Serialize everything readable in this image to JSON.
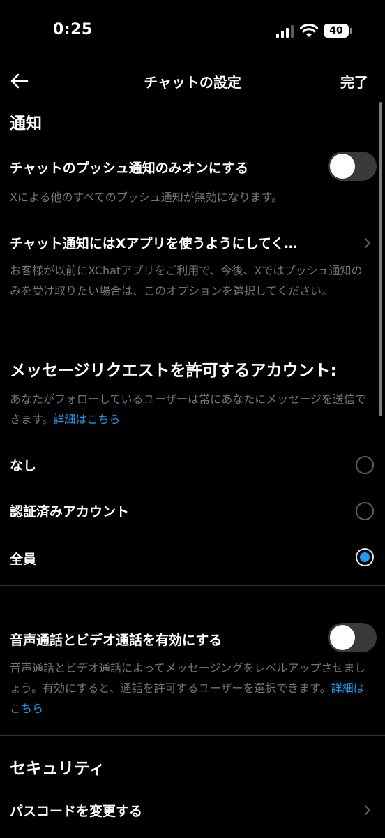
{
  "status_bar": {
    "time": "0:25",
    "battery": "40",
    "signal_icon": "cellular-signal-icon",
    "wifi_icon": "wifi-icon"
  },
  "nav": {
    "back_icon": "arrow-left-icon",
    "title": "チャットの設定",
    "done": "完了"
  },
  "notifications": {
    "heading": "通知",
    "push_only": {
      "label": "チャットのプッシュ通知のみオンにする",
      "on": false,
      "description": "Xによる他のすべてのプッシュ通知が無効になります。"
    },
    "use_x_app": {
      "label": "チャット通知にはXアプリを使うようにしてく…",
      "description": "お客様が以前にXChatアプリをご利用で、今後、Xではプッシュ通知のみを受け取りたい場合は、このオプションを選択してください。"
    }
  },
  "message_requests": {
    "heading": "メッセージリクエストを許可するアカウント:",
    "description": "あなたがフォローしているユーザーは常にあなたにメッセージを送信できます。",
    "learn_more": "詳細はこちら",
    "options": [
      {
        "label": "なし",
        "selected": false
      },
      {
        "label": "認証済みアカウント",
        "selected": false
      },
      {
        "label": "全員",
        "selected": true
      }
    ]
  },
  "calls": {
    "label": "音声通話とビデオ通話を有効にする",
    "on": false,
    "description": "音声通話とビデオ通話によってメッセージングをレベルアップさせましょう。有効にすると、通話を許可するユーザーを選択できます。",
    "learn_more": "詳細はこちら"
  },
  "security": {
    "heading": "セキュリティ",
    "change_passcode": "パスコードを変更する"
  },
  "colors": {
    "background": "#000000",
    "text": "#e7e9ea",
    "secondary_text": "#71767b",
    "accent": "#1d9bf0",
    "divider": "#2f3336",
    "toggle_off": "#3a3a3c"
  }
}
